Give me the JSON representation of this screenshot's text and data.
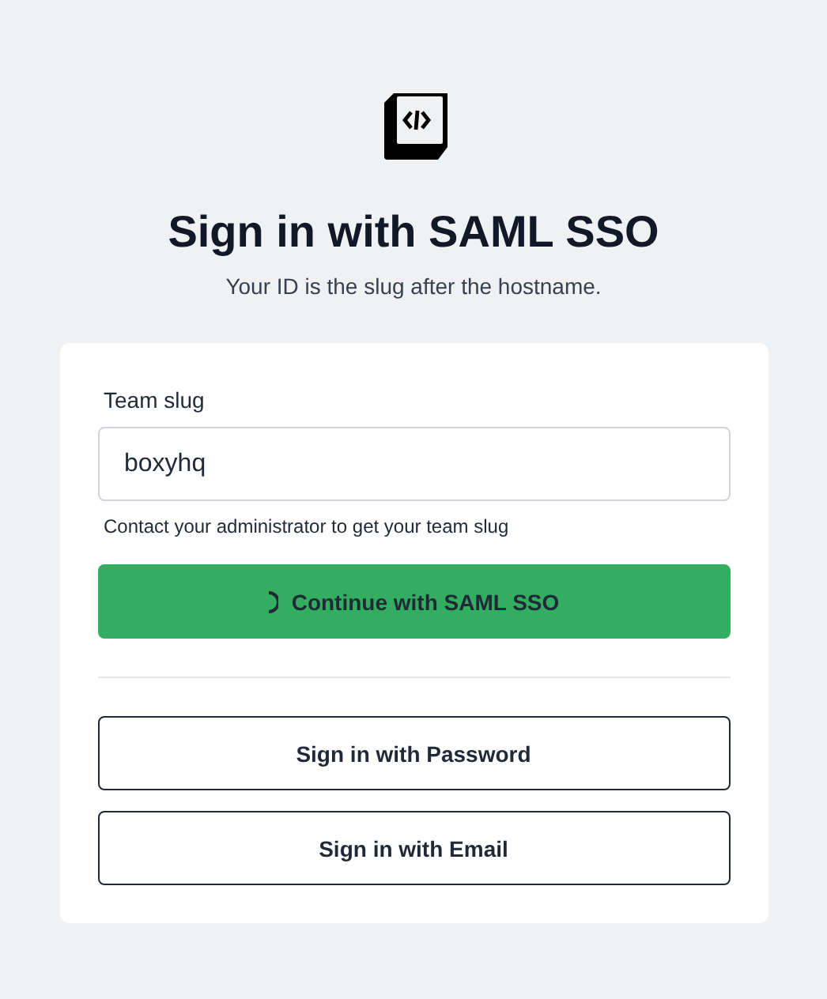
{
  "title": "Sign in with SAML SSO",
  "subtitle": "Your ID is the slug after the hostname.",
  "form": {
    "label": "Team slug",
    "value": "boxyhq",
    "help": "Contact your administrator to get your team slug"
  },
  "primary_button": {
    "label": "Continue with SAML SSO",
    "loading": true
  },
  "alt_buttons": [
    {
      "label": "Sign in with Password"
    },
    {
      "label": "Sign in with Email"
    }
  ]
}
